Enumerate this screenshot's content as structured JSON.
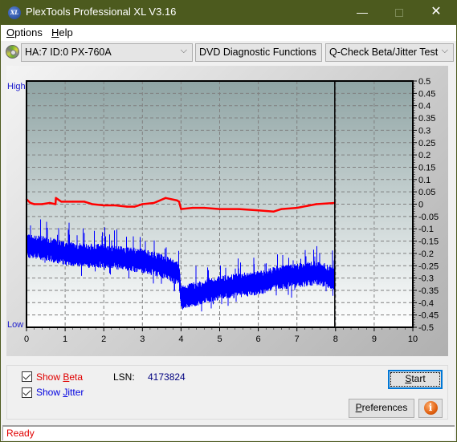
{
  "window": {
    "title": "PlexTools Professional XL V3.16",
    "app_icon_label": "XL",
    "minimize_glyph": "—",
    "close_glyph": "✕"
  },
  "menu": {
    "items": [
      {
        "label": "Options",
        "mnemonic": "O",
        "rest": "ptions"
      },
      {
        "label": "Help",
        "mnemonic": "H",
        "rest": "elp"
      }
    ]
  },
  "toolbar": {
    "drive": "HA:7 ID:0  PX-760A",
    "function": "DVD Diagnostic Functions",
    "test": "Q-Check Beta/Jitter Test",
    "chevron": "⌵"
  },
  "controls": {
    "show_beta": {
      "label_pre": "Show ",
      "mnemonic": "B",
      "label_post": "eta",
      "checked": true,
      "color": "#e00000"
    },
    "show_jitter": {
      "label_pre": "Show ",
      "mnemonic": "J",
      "label_post": "itter",
      "checked": true,
      "color": "#0000e0"
    },
    "lsn_label": "LSN:",
    "lsn_value": "4173824",
    "start_button": {
      "mnemonic": "S",
      "rest": "tart"
    },
    "preferences_button": {
      "mnemonic": "P",
      "rest": "references"
    },
    "info_button_glyph": "i"
  },
  "status": {
    "text": "Ready"
  },
  "chart_data": {
    "type": "line",
    "title": "",
    "xlabel": "",
    "ylabel": "",
    "left_axis_labels": {
      "top": "High",
      "bottom": "Low"
    },
    "xlim": [
      0,
      10
    ],
    "ylim": [
      -0.5,
      0.5
    ],
    "x_ticks": [
      0,
      1,
      2,
      3,
      4,
      5,
      6,
      7,
      8,
      9,
      10
    ],
    "y_ticks": [
      0.5,
      0.45,
      0.4,
      0.35,
      0.3,
      0.25,
      0.2,
      0.15,
      0.1,
      0.05,
      0,
      -0.05,
      -0.1,
      -0.15,
      -0.2,
      -0.25,
      -0.3,
      -0.35,
      -0.4,
      -0.45,
      -0.5
    ],
    "grid": true,
    "marker_line_x": 7.98,
    "series": [
      {
        "name": "Beta",
        "color": "#ff0000",
        "x": [
          0,
          0.1,
          0.2,
          0.4,
          0.6,
          0.75,
          0.76,
          0.9,
          1.2,
          1.5,
          1.7,
          2.0,
          2.3,
          2.6,
          2.8,
          3.0,
          3.3,
          3.6,
          3.9,
          3.95,
          4.0,
          4.3,
          4.6,
          5.0,
          5.5,
          6.0,
          6.4,
          6.6,
          7.0,
          7.5,
          7.98
        ],
        "values": [
          0.02,
          0.005,
          0.0,
          0.0,
          0.005,
          0.0,
          0.025,
          0.01,
          0.01,
          0.01,
          0.0,
          -0.005,
          -0.005,
          -0.01,
          -0.01,
          0.0,
          0.005,
          0.025,
          0.015,
          0.01,
          -0.02,
          -0.015,
          -0.015,
          -0.02,
          -0.02,
          -0.025,
          -0.03,
          -0.02,
          -0.015,
          0.0,
          0.005
        ]
      },
      {
        "name": "Jitter",
        "color": "#0000ff",
        "x": [
          0,
          0.5,
          1.0,
          1.5,
          2.0,
          2.5,
          3.0,
          3.5,
          3.9,
          3.95,
          4.0,
          4.5,
          5.0,
          5.5,
          6.0,
          6.5,
          7.0,
          7.5,
          7.98
        ],
        "values": [
          -0.17,
          -0.18,
          -0.2,
          -0.21,
          -0.21,
          -0.22,
          -0.23,
          -0.25,
          -0.28,
          -0.29,
          -0.38,
          -0.36,
          -0.34,
          -0.33,
          -0.32,
          -0.3,
          -0.29,
          -0.28,
          -0.3
        ],
        "spread": 0.045
      }
    ]
  }
}
